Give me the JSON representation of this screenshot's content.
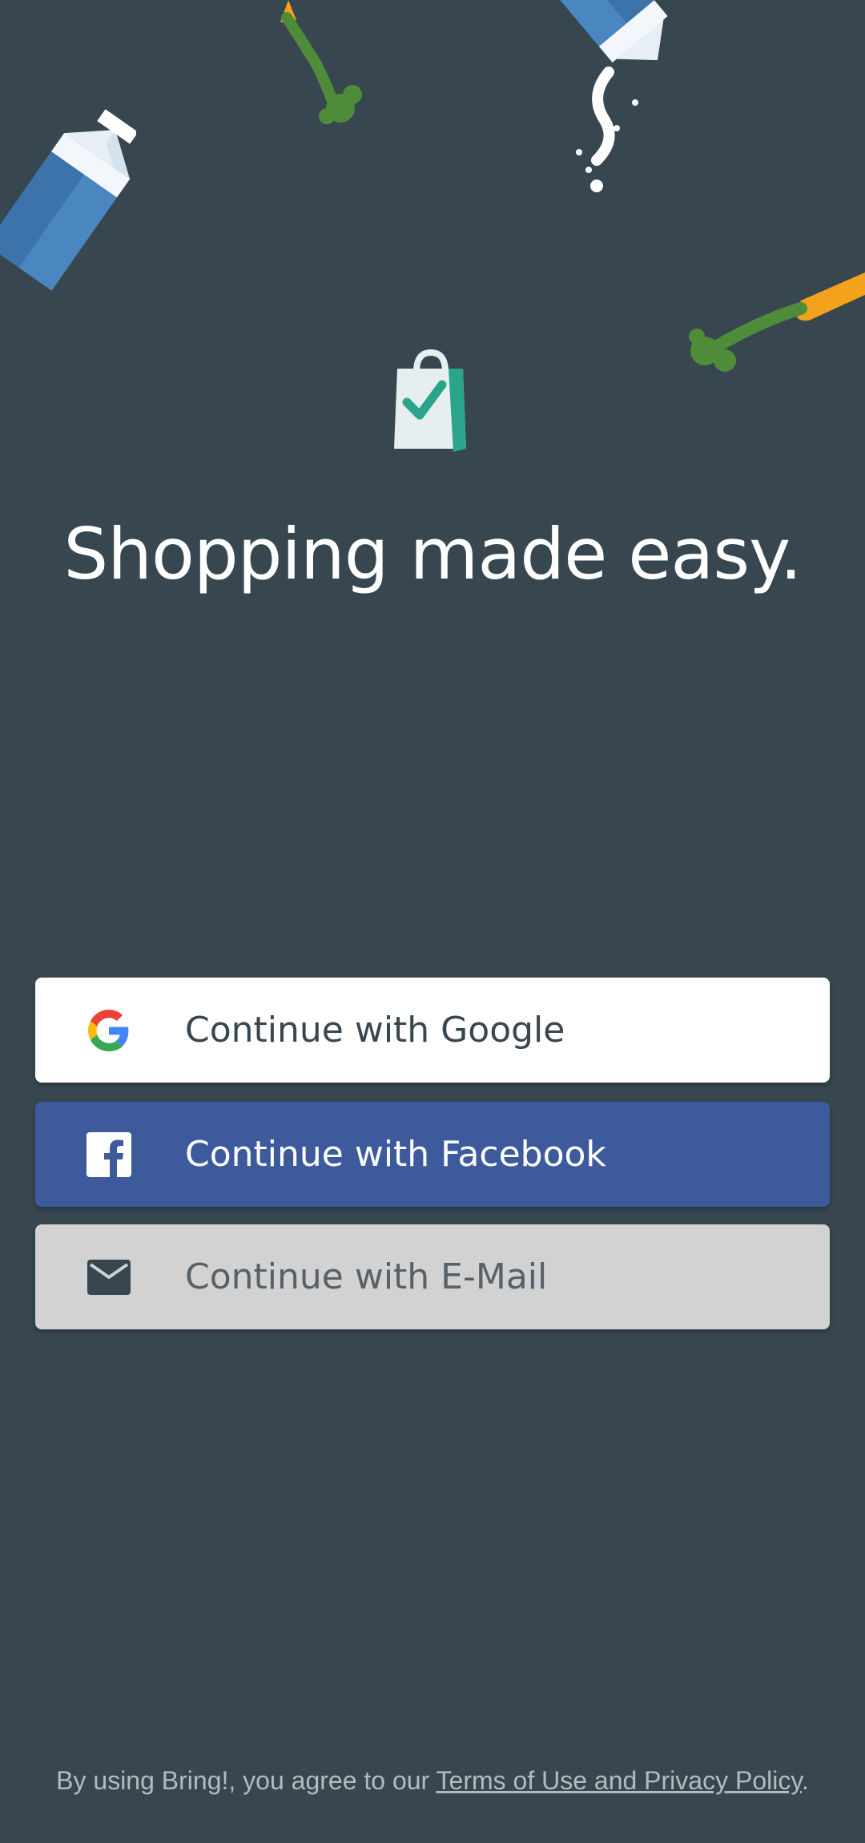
{
  "headline": "Shopping made easy.",
  "buttons": {
    "google": {
      "label": "Continue with Google",
      "icon": "google-icon",
      "bg": "#ffffff"
    },
    "facebook": {
      "label": "Continue with Facebook",
      "icon": "facebook-icon",
      "bg": "#3d5a9c"
    },
    "email": {
      "label": "Continue with E-Mail",
      "icon": "mail-icon",
      "bg": "#d2d2d2"
    }
  },
  "footer": {
    "prefix": "By using Bring!, you agree to our ",
    "link": "Terms of Use and Privacy Policy",
    "suffix": "."
  },
  "colors": {
    "background": "#37464f",
    "accent": "#2aa58c",
    "milk_blue": "#4a86c0",
    "carrot": "#f4a21c",
    "leaf": "#4f8c3a"
  }
}
